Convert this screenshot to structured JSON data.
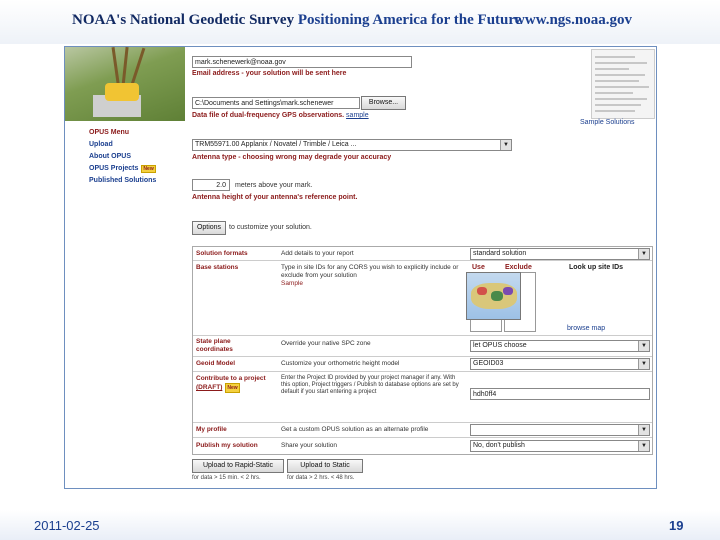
{
  "slide": {
    "header_org": "NOAA's",
    "header_name": "National Geodetic Survey",
    "header_tagline": "Positioning America for the Future",
    "header_url": "www.ngs.noaa.gov",
    "date": "2011-02-25",
    "page_number": "19"
  },
  "form": {
    "email_value": "mark.schenewerk@noaa.gov",
    "email_hint": "Email address - your solution will be sent here",
    "file_value": "C:\\Documents and Settings\\mark.schenewer",
    "browse_label": "Browse...",
    "file_hint": "Data file of dual-frequency GPS observations.",
    "file_hint_link": "sample",
    "antenna_value": "TRM55971.00    Applanix / Novatel / Trimble / Leica ...",
    "antenna_hint": "Antenna type - choosing wrong may degrade your accuracy",
    "height_value": "2.0",
    "height_units": "meters above your mark.",
    "height_hint": "Antenna height of your antenna's reference point.",
    "options_label": "Options",
    "options_hint": "to customize your solution.",
    "sample_solutions": "Sample Solutions"
  },
  "menu": {
    "heading": "OPUS Menu",
    "items": [
      "Upload",
      "About OPUS",
      "OPUS Projects",
      "Published Solutions"
    ],
    "new_badge": "New"
  },
  "options_table": {
    "rows": [
      {
        "label": "Solution formats",
        "desc": "Add details to your report",
        "value": "standard solution"
      },
      {
        "label": "Base stations",
        "desc": "Type in site IDs for any CORS you wish to explicitly include or exclude from your solution",
        "desc_link": "Sample",
        "use_label": "Use",
        "exclude_label": "Exclude",
        "lookup_label": "Look up site IDs",
        "map_link": "browse map"
      },
      {
        "label": "State plane coordinates",
        "desc": "Override your native SPC zone",
        "value": "let OPUS choose"
      },
      {
        "label": "Geoid Model",
        "desc": "Customize your orthometric height model",
        "value": "GEOID03"
      },
      {
        "label": "Contribute to a project",
        "label_link": "(DRAFT)",
        "desc": "Enter the Project ID provided by your project manager if any. With this option, Project triggers / Publish to database options are set by default if you start entering a project",
        "value": "hdh0ff4"
      },
      {
        "label": "My profile",
        "desc": "Get a custom OPUS solution as an alternate profile",
        "value": ""
      },
      {
        "label": "Publish my solution",
        "desc": "Share your solution",
        "value": "No, don't publish"
      }
    ]
  },
  "buttons": {
    "rapid_static": "Upload to Rapid-Static",
    "rapid_static_note": "for data > 15 min. < 2 hrs.",
    "static": "Upload to Static",
    "static_note": "for data > 2 hrs. < 48 hrs."
  }
}
